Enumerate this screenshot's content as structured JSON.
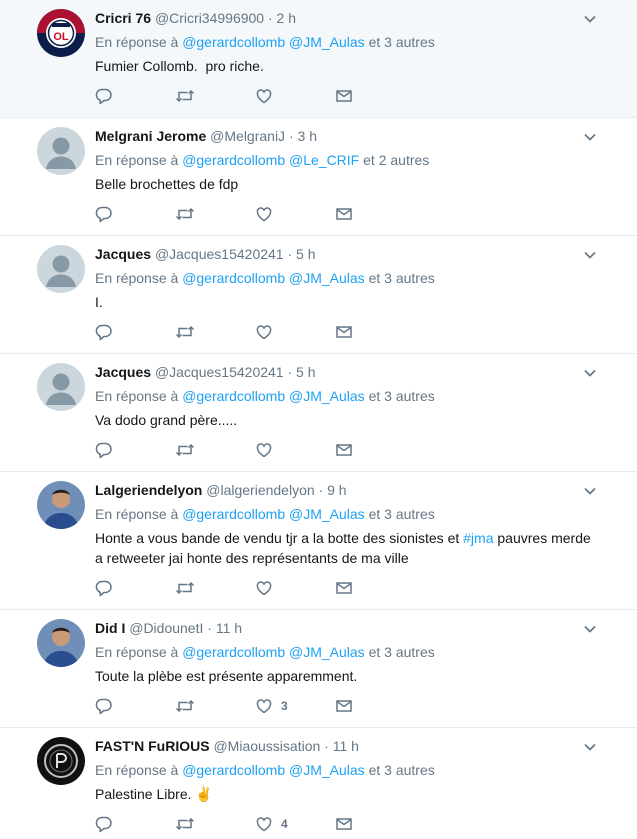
{
  "reply_prefix": "En réponse à",
  "colors": {
    "link": "#1da1f2",
    "muted": "#657786",
    "highlight_bg": "#f5f8fa",
    "border": "#e6ecf0"
  },
  "tweets": [
    {
      "fullname": "Cricri 76",
      "handle": "@Cricri34996900",
      "time": "2 h",
      "mention1": "@gerardcollomb",
      "mention2": "@JM_Aulas",
      "others": " et 3 autres",
      "text": "Fumier Collomb.  pro riche.",
      "likes": "",
      "avatar": "ol-logo-icon"
    },
    {
      "fullname": "Melgrani Jerome",
      "handle": "@MelgraniJ",
      "time": "3 h",
      "mention1": "@gerardcollomb",
      "mention2": "@Le_CRIF",
      "others": " et 2 autres",
      "text": "Belle brochettes de fdp",
      "likes": "",
      "avatar": "default-avatar-icon"
    },
    {
      "fullname": "Jacques",
      "handle": "@Jacques15420241",
      "time": "5 h",
      "mention1": "@gerardcollomb",
      "mention2": "@JM_Aulas",
      "others": " et 3 autres",
      "text": "I.",
      "likes": "",
      "avatar": "default-avatar-icon"
    },
    {
      "fullname": "Jacques",
      "handle": "@Jacques15420241",
      "time": "5 h",
      "mention1": "@gerardcollomb",
      "mention2": "@JM_Aulas",
      "others": " et 3 autres",
      "text": "Va dodo grand père.....",
      "likes": "",
      "avatar": "default-avatar-icon"
    },
    {
      "fullname": "Lalgeriendelyon",
      "handle": "@lalgeriendelyon",
      "time": "9 h",
      "mention1": "@gerardcollomb",
      "mention2": "@JM_Aulas",
      "others": " et 3 autres",
      "text_before": "Honte a vous bande de vendu tjr a la botte des sionistes et ",
      "hashtag": "#jma",
      "text_after": " pauvres merde a retweeter jai honte des représentants de ma ville",
      "likes": "",
      "avatar": "photo-avatar-icon"
    },
    {
      "fullname": "Did I",
      "handle": "@DidounetI",
      "time": "11 h",
      "mention1": "@gerardcollomb",
      "mention2": "@JM_Aulas",
      "others": " et 3 autres",
      "text": "Toute la plèbe est présente apparemment.",
      "likes": "3",
      "avatar": "photo-avatar-icon"
    },
    {
      "fullname": "FAST'N FuRIOUS",
      "handle": "@Miaoussisation",
      "time": "11 h",
      "mention1": "@gerardcollomb",
      "mention2": "@JM_Aulas",
      "others": " et 3 autres",
      "text": "Palestine Libre. ",
      "emoji": "✌",
      "likes": "4",
      "avatar": "psg-logo-icon"
    }
  ]
}
